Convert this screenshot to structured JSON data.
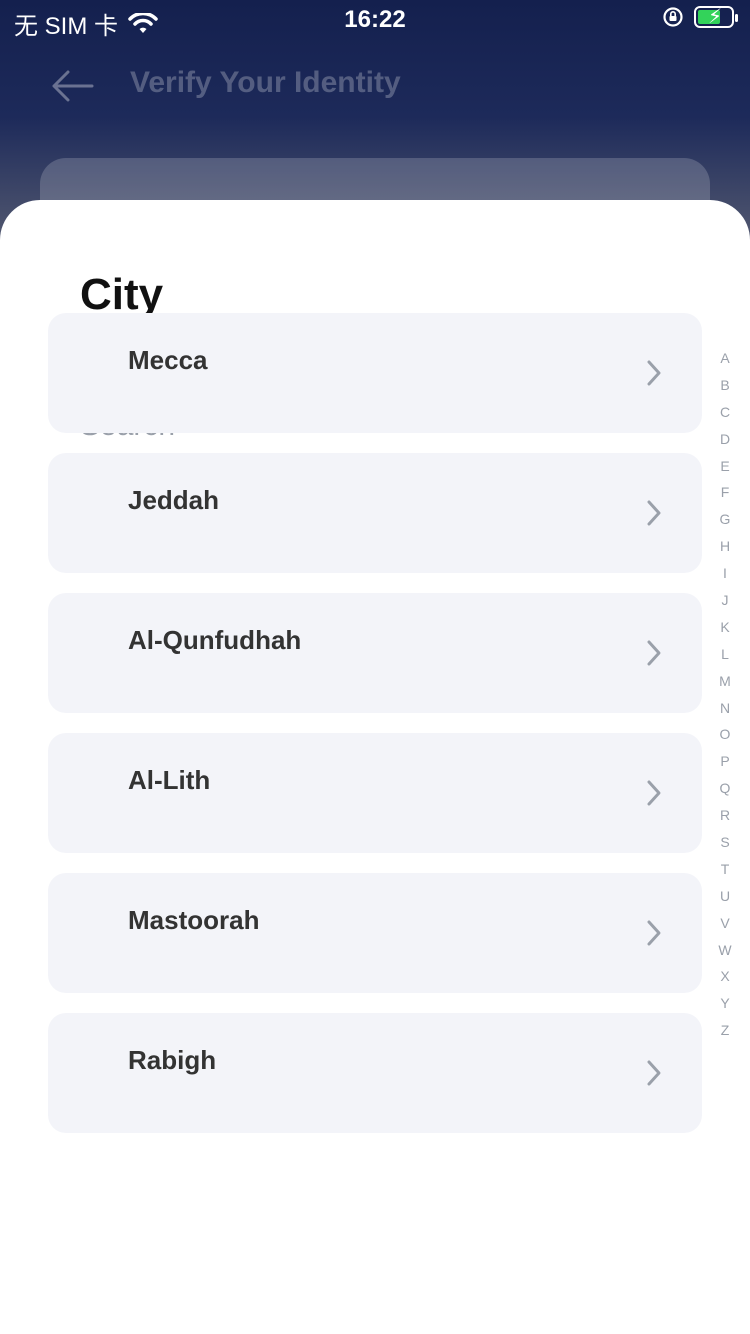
{
  "status_bar": {
    "carrier": "无 SIM 卡",
    "time": "16:22",
    "wifi_icon": "wifi-icon",
    "lock_icon": "orientation-lock-icon",
    "battery_icon": "battery-charging-icon"
  },
  "header": {
    "title": "Verify Your Identity",
    "back_icon": "arrow-left-icon"
  },
  "sheet": {
    "title": "City",
    "search_placeholder": "Search"
  },
  "cities": [
    {
      "label": "Mecca"
    },
    {
      "label": "Jeddah"
    },
    {
      "label": "Al-Qunfudhah"
    },
    {
      "label": "Al-Lith"
    },
    {
      "label": "Mastoorah"
    },
    {
      "label": "Rabigh"
    }
  ],
  "index_letters": [
    "A",
    "B",
    "C",
    "D",
    "E",
    "F",
    "G",
    "H",
    "I",
    "J",
    "K",
    "L",
    "M",
    "N",
    "O",
    "P",
    "Q",
    "R",
    "S",
    "T",
    "U",
    "V",
    "W",
    "X",
    "Y",
    "Z"
  ],
  "colors": {
    "header_bg": "#14204e",
    "item_bg": "#f3f4f9",
    "index_text": "#9aa0aa",
    "battery_fill": "#33d35a"
  }
}
